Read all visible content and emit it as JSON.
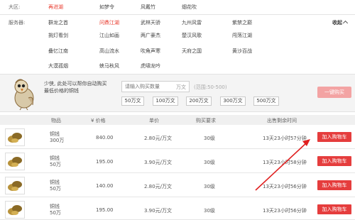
{
  "filters": {
    "region_label": "大区:",
    "server_label": "服务器:",
    "region_items": [
      "再进湖",
      "如梦令",
      "风戴竹",
      "烟花吹"
    ],
    "active_region_index": 0,
    "server_rows": [
      [
        "群龙之首",
        "问鼎江湖",
        "武林天骄",
        "九州风雷",
        "紫禁之巅"
      ],
      [
        "挑灯看剑",
        "江山如画",
        "两广豪杰",
        "楚汉风歌",
        "闯荡江湖"
      ],
      [
        "叠忆江南",
        "高山流水",
        "吹角声寒",
        "天府之国",
        "黄沙百战"
      ],
      [
        "大漠孤烟",
        "蛱马秋风",
        "虎啸龙吟"
      ]
    ],
    "active_server": "问鼎江湖",
    "collapse_label": "收起"
  },
  "helper": {
    "bubble_text": "少侠, 此处可以帮你自动购买最低价格的铜钱",
    "qty_placeholder": "请输入购买数量",
    "unit_label": "万文",
    "range_hint": "(范围:50-500)",
    "quick_qty": [
      "50万文",
      "100万文",
      "200万文",
      "300万文",
      "500万文"
    ],
    "buy_button": "一键购买"
  },
  "table": {
    "headers": {
      "item": "物品",
      "price": "¥ 价格",
      "unit_price": "单价",
      "requirement": "购买要求",
      "remaining": "出售剩余时间"
    },
    "rows": [
      {
        "name": "铜钱",
        "qty": "300万",
        "price": "840.00",
        "unit_price": "2.80元/万文",
        "requirement": "30级",
        "remaining": "13天23小时57分钟",
        "action": "加入购物车"
      },
      {
        "name": "铜钱",
        "qty": "50万",
        "price": "195.00",
        "unit_price": "3.90元/万文",
        "requirement": "30级",
        "remaining": "13天23小时58分钟",
        "action": "加入购物车"
      },
      {
        "name": "铜钱",
        "qty": "50万",
        "price": "140.00",
        "unit_price": "2.80元/万文",
        "requirement": "30级",
        "remaining": "13天23小时56分钟",
        "action": "加入购物车"
      },
      {
        "name": "铜钱",
        "qty": "50万",
        "price": "195.00",
        "unit_price": "3.90元/万文",
        "requirement": "30级",
        "remaining": "13天23小时56分钟",
        "action": "加入购物车"
      }
    ]
  },
  "colors": {
    "accent": "#e53d3d",
    "active_link": "#e8382b",
    "annotation_arrow": "#e02020",
    "disabled_buy": "#f3a3a3"
  }
}
